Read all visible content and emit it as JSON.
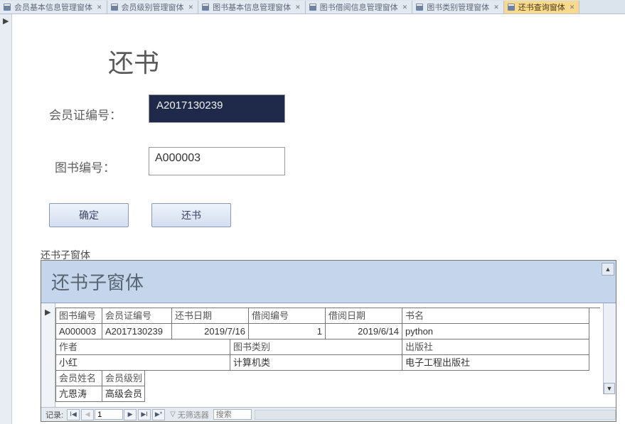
{
  "tabs": [
    {
      "label": "会员基本信息管理窗体"
    },
    {
      "label": "会员级别管理窗体"
    },
    {
      "label": "图书基本信息管理窗体"
    },
    {
      "label": "图书借阅信息管理窗体"
    },
    {
      "label": "图书类别管理窗体"
    },
    {
      "label": "还书查询窗体"
    }
  ],
  "active_tab_index": 5,
  "form": {
    "title": "还书",
    "fields": {
      "member_no": {
        "label": "会员证编号：",
        "value": "A2017130239"
      },
      "book_no": {
        "label": "图书编号：",
        "value": "A000003"
      }
    },
    "buttons": {
      "ok": "确定",
      "return": "还书"
    }
  },
  "subform": {
    "outer_label": "还书子窗体",
    "header_title": "还书子窗体",
    "row1_headers": [
      "图书编号",
      "会员证编号",
      "还书日期",
      "借阅编号",
      "借阅日期",
      "书名"
    ],
    "row1_values": [
      "A000003",
      "A2017130239",
      "2019/7/16",
      "1",
      "2019/6/14",
      "python"
    ],
    "row2_headers": [
      "作者",
      "图书类别",
      "出版社"
    ],
    "row2_values": [
      "小红",
      "计算机类",
      "电子工程出版社"
    ],
    "row3_headers": [
      "会员姓名",
      "会员级别"
    ],
    "row3_values": [
      "亢恩涛",
      "高级会员"
    ]
  },
  "recnav": {
    "label": "记录:",
    "current": "1",
    "filter_text": "无筛选器",
    "search_placeholder": "搜索"
  }
}
